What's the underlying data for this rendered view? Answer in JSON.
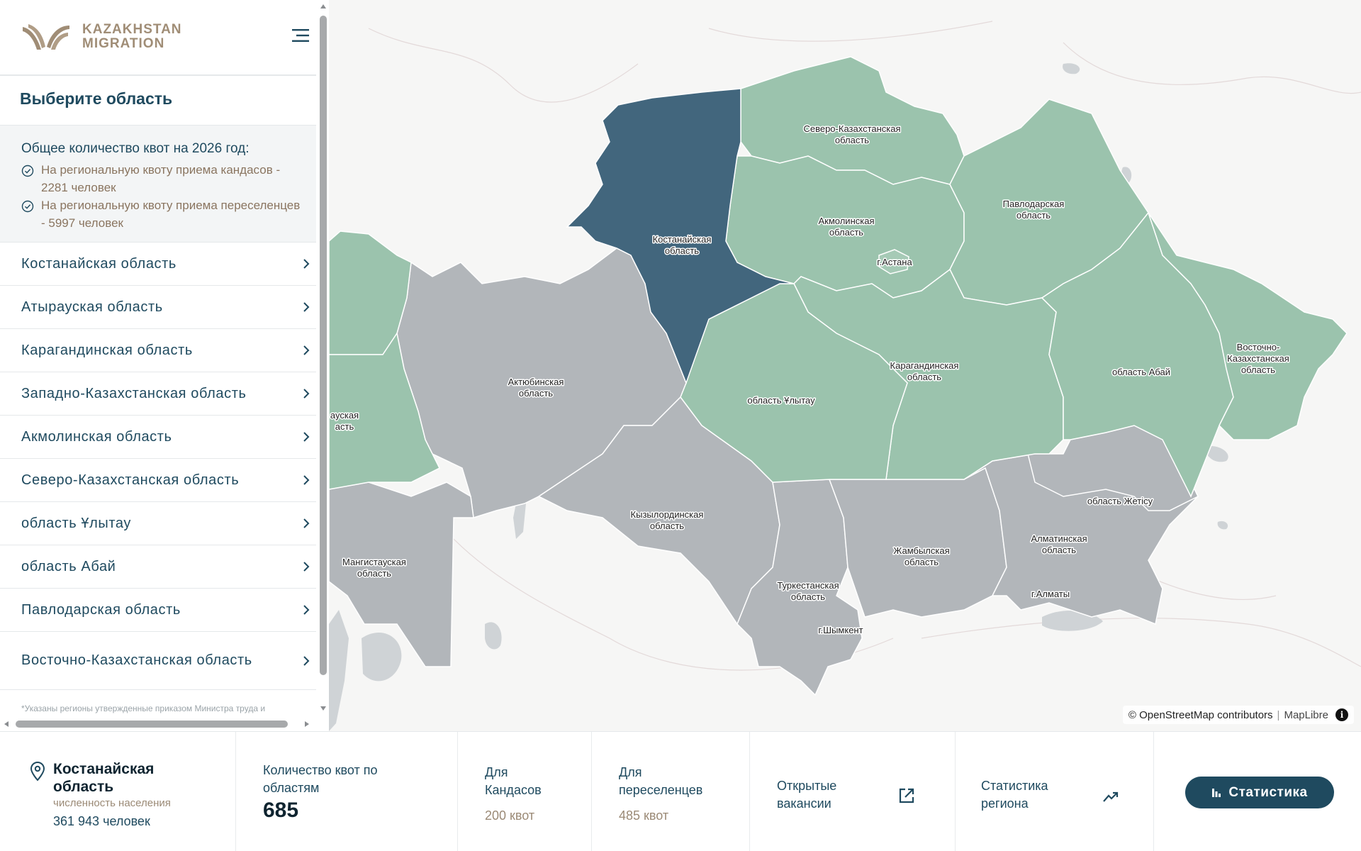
{
  "brand": {
    "line1": "KAZAKHSTAN",
    "line2": "MIGRATION"
  },
  "sidebar": {
    "title": "Выберите область",
    "quota_heading": "Общее количество квот на 2026 год:",
    "quota_items": [
      "На региональную квоту приема кандасов - 2281 человек",
      "На региональную квоту приема переселенцев - 5997 человек"
    ],
    "regions": [
      "Костанайская область",
      "Атырауская область",
      "Карагандинская область",
      "Западно-Казахстанская область",
      "Акмолинская область",
      "Северо-Казахстанская область",
      "область Ұлытау",
      "область Абай",
      "Павлодарская область",
      "Восточно-Казахстанская область"
    ],
    "footnote": "*Указаны регионы утвержденные приказом Министра труда и"
  },
  "map": {
    "labels": {
      "kostanay": [
        "Костанайская",
        "область"
      ],
      "sko": [
        "Северо-Казахстанская",
        "область"
      ],
      "akmola": [
        "Акмолинская",
        "область"
      ],
      "astana": "г.Астана",
      "pavlodar": [
        "Павлодарская",
        "область"
      ],
      "vko": [
        "Восточно-",
        "Казахстанская",
        "область"
      ],
      "abai": "область Абай",
      "karaganda": [
        "Карагандинская",
        "область"
      ],
      "ulytau": "область Ұлытау",
      "aktobe": [
        "Актюбинская",
        "область"
      ],
      "atyrau": [
        "ауская",
        "асть"
      ],
      "kyzylorda": [
        "Кызылординская",
        "область"
      ],
      "mangystau": [
        "Мангистауская",
        "область"
      ],
      "zhambyl": [
        "Жамбылская",
        "область"
      ],
      "turkestan": [
        "Туркестанская",
        "область"
      ],
      "shymkent": "г.Шымкент",
      "almaty_obl": [
        "Алматинская",
        "область"
      ],
      "almaty": "г.Алматы",
      "zhetisu": "область Жетісу"
    },
    "attribution": {
      "osm": "© OpenStreetMap contributors",
      "maplibre": "MapLibre",
      "info": "i"
    },
    "colors": {
      "selected": "#42667d",
      "quota": "#9bc3ad",
      "other": "#b2b6ba",
      "water": "#cfd3d6"
    }
  },
  "bottom": {
    "region_name": "Костанайская область",
    "population_label": "численность населения",
    "population_value": "361 943 человек",
    "quota_label": "Количество квот по областям",
    "quota_total": "685",
    "kandas_label": "Для Кандасов",
    "kandas_value": "200 квот",
    "resettlers_label": "Для переселенцев",
    "resettlers_value": "485 квот",
    "vacancies_label": "Открытые вакансии",
    "region_stats_label": "Статистика региона",
    "stats_button": "Статистика"
  }
}
